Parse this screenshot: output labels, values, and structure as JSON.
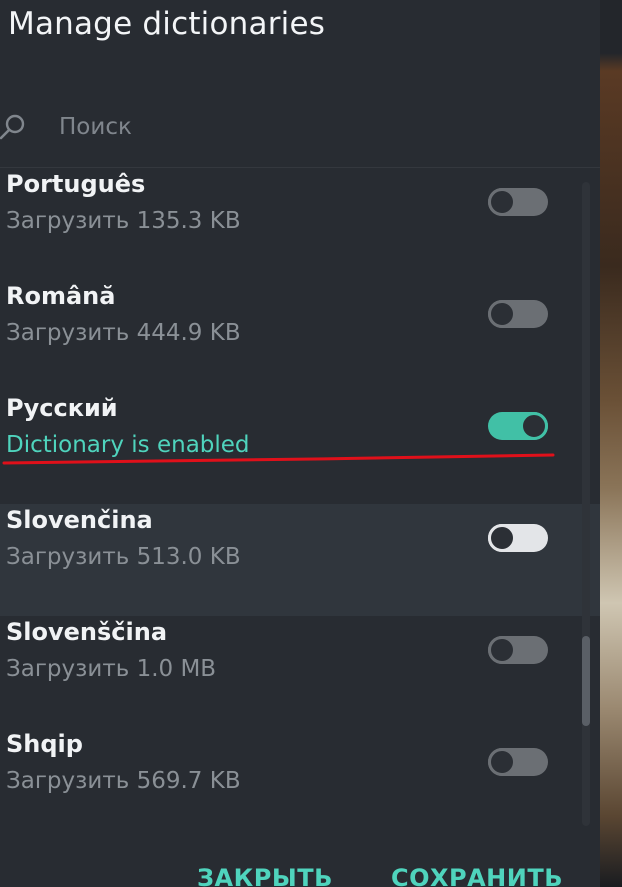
{
  "dialog": {
    "title": "Manage dictionaries"
  },
  "search": {
    "placeholder": "Поиск",
    "value": ""
  },
  "dictionaries": [
    {
      "name": "Português",
      "status": "Загрузить 135.3 KB",
      "enabled": false
    },
    {
      "name": "Română",
      "status": "Загрузить 444.9 KB",
      "enabled": false
    },
    {
      "name": "Русский",
      "status": "Dictionary is enabled",
      "enabled": true
    },
    {
      "name": "Slovenčina",
      "status": "Загрузить 513.0 KB",
      "enabled": false
    },
    {
      "name": "Slovenščina",
      "status": "Загрузить 1.0 MB",
      "enabled": false
    },
    {
      "name": "Shqip",
      "status": "Загрузить 569.7 KB",
      "enabled": false
    }
  ],
  "footer": {
    "close_label": "ЗАКРЫТЬ",
    "save_label": "СОХРАНИТЬ"
  },
  "colors": {
    "accent": "#4fd4bd",
    "annotation": "#e0101a",
    "background": "#282c32"
  }
}
